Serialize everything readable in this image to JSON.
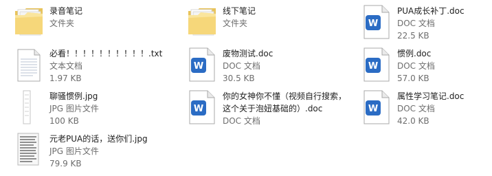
{
  "files": [
    {
      "name": "录音笔记",
      "type": "文件夹",
      "size": "",
      "icon": "folder-icon"
    },
    {
      "name": "线下笔记",
      "type": "文件夹",
      "size": "",
      "icon": "folder-icon"
    },
    {
      "name": "PUA成长补丁.doc",
      "type": "DOC 文档",
      "size": "22.5 KB",
      "icon": "word-doc-icon"
    },
    {
      "name": "必看！！！！！！！！！！.txt",
      "type": "文本文档",
      "size": "1.97 KB",
      "icon": "text-file-icon"
    },
    {
      "name": "废物测试.doc",
      "type": "DOC 文档",
      "size": "30.5 KB",
      "icon": "word-doc-icon"
    },
    {
      "name": "惯例.doc",
      "type": "DOC 文档",
      "size": "57.0 KB",
      "icon": "word-doc-icon"
    },
    {
      "name": "聊骚惯例.jpg",
      "type": "JPG 图片文件",
      "size": "100 KB",
      "icon": "jpg-thumbnail-icon"
    },
    {
      "name": "你的女神你不懂（视频自行搜索，这个关于泡妞基础的）.doc",
      "type": "DOC 文档",
      "size": "",
      "icon": "word-doc-icon"
    },
    {
      "name": "属性学习笔记.doc",
      "type": "DOC 文档",
      "size": "42.0 KB",
      "icon": "word-doc-icon"
    },
    {
      "name": "元老PUA的话，送你们.jpg",
      "type": "JPG 图片文件",
      "size": "79.9 KB",
      "icon": "jpg-thumbnail-icon"
    }
  ]
}
